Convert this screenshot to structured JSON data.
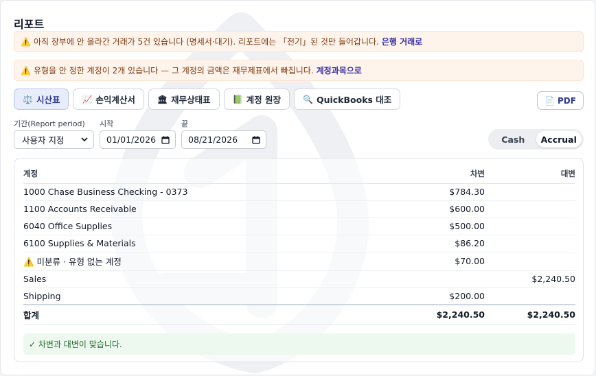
{
  "page": {
    "title": "리포트"
  },
  "banners": {
    "pending": {
      "icon": "warning-icon",
      "text": "아직 장부에 안 올라간 거래가 5건 있습니다 (명세서·대기). 리포트에는 「전기」된 것만 들어갑니다.",
      "link": "은행 거래로"
    },
    "untyped": {
      "icon": "warning-icon",
      "text": "유형을 안 정한 계정이 2개 있습니다 — 그 계정의 금액은 재무제표에서 빠집니다.",
      "link": "계정과목으로"
    }
  },
  "tabs": [
    {
      "icon": "⚖️",
      "icon_name": "balance-scale-icon",
      "label": "시산표",
      "active": true
    },
    {
      "icon": "📈",
      "icon_name": "chart-up-icon",
      "label": "손익계산서",
      "active": false
    },
    {
      "icon": "🏛",
      "icon_name": "bank-building-icon",
      "label": "재무상태표",
      "active": false
    },
    {
      "icon": "📗",
      "icon_name": "green-book-icon",
      "label": "계정 원장",
      "active": false
    },
    {
      "icon": "🔍",
      "icon_name": "magnifier-icon",
      "label": "QuickBooks 대조",
      "active": false
    }
  ],
  "pdf_button": {
    "icon": "📄",
    "icon_name": "document-icon",
    "label": "PDF"
  },
  "filters": {
    "period_label": "기간(Report period)",
    "period_value": "사용자 지정",
    "start_label": "시작",
    "start_value": "01/01/2026",
    "end_label": "끝",
    "end_value": "08/21/2026"
  },
  "basis_toggle": {
    "options": [
      "Cash",
      "Accrual"
    ],
    "selected": "Accrual"
  },
  "table": {
    "headers": {
      "account": "계정",
      "debit": "차변",
      "credit": "대변"
    },
    "rows": [
      {
        "account": "1000 Chase Business Checking - 0373",
        "debit": "$784.30",
        "credit": ""
      },
      {
        "account": "1100 Accounts Receivable",
        "debit": "$600.00",
        "credit": ""
      },
      {
        "account": "6040 Office Supplies",
        "debit": "$500.00",
        "credit": ""
      },
      {
        "account": "6100 Supplies & Materials",
        "debit": "$86.20",
        "credit": ""
      },
      {
        "account": "⚠️ 미분류 · 유형 없는 계정",
        "debit": "$70.00",
        "credit": ""
      },
      {
        "account": "Sales",
        "debit": "",
        "credit": "$2,240.50"
      },
      {
        "account": "Shipping",
        "debit": "$200.00",
        "credit": ""
      }
    ],
    "total": {
      "label": "합계",
      "debit": "$2,240.50",
      "credit": "$2,240.50"
    }
  },
  "balance_status": {
    "text": "✓ 차변과 대변이 맞습니다."
  },
  "colors": {
    "accent": "#2e3a8c",
    "warning_bg": "#fff4ec",
    "success_bg": "#edf8ee",
    "success_text": "#276b33"
  }
}
